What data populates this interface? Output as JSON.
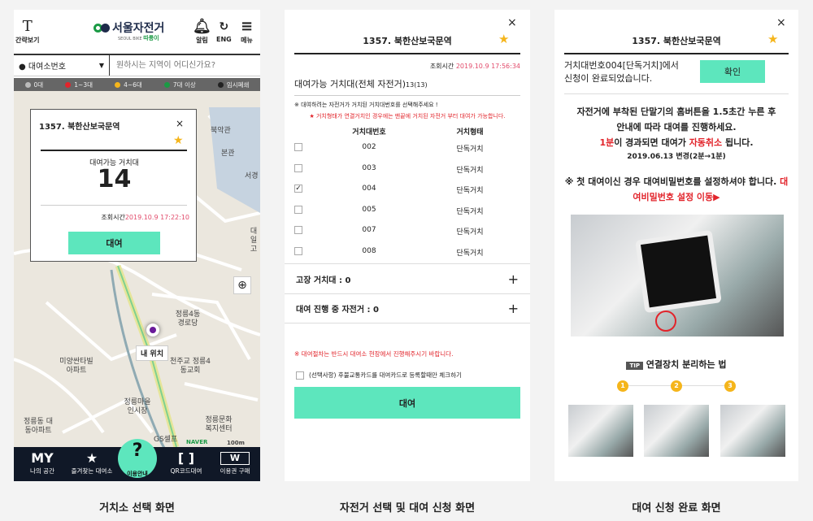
{
  "captions": [
    "거치소 선택 화면",
    "자전거 선택 및 대여 신청 화면",
    "대여 신청 완료 화면"
  ],
  "screen1": {
    "top": {
      "simple": "간략보기",
      "logo": "서울자전거",
      "logo_sub": "SEOUL BIKE",
      "logo_brand": "따릉이",
      "alarm": "알림",
      "eng": "ENG",
      "menu": "메뉴"
    },
    "search": {
      "select": "대여소번호",
      "placeholder": "원하시는 지역이 어디신가요?"
    },
    "legend": [
      {
        "label": "0대",
        "color": "#bbbbbb"
      },
      {
        "label": "1~3대",
        "color": "#e2242b"
      },
      {
        "label": "4~6대",
        "color": "#f5b51b"
      },
      {
        "label": "7대 이상",
        "color": "#1a9a44"
      },
      {
        "label": "임시폐쇄",
        "color": "#222222"
      }
    ],
    "popup": {
      "title": "1357. 북한산보국문역",
      "available_label": "대여가능 거치대",
      "count": "14",
      "time_label": "조회시간",
      "time": "2019.10.9 17:22:10",
      "rent": "대여"
    },
    "map_labels": [
      "북악관",
      "본관",
      "서경",
      "대일 고",
      "정릉4동 경로당",
      "내 위치",
      "천주교 정릉4동교회",
      "미양싼타빌 아파트",
      "정릉마을 인시장",
      "정릉동 대동아파트",
      "GS셀프",
      "정릉문화 복지센터",
      "NAVER",
      "100m"
    ],
    "nav": [
      {
        "icon": "MY",
        "label": "나의 공간"
      },
      {
        "icon": "★",
        "label": "즐겨찾는 대여소"
      },
      {
        "icon": "?",
        "label": "이용안내"
      },
      {
        "icon": "[ ]",
        "label": "QR코드대여"
      },
      {
        "icon": "W",
        "label": "이용권 구매"
      }
    ]
  },
  "screen2": {
    "title": "1357. 북한산보국문역",
    "time_label": "조회시간",
    "time": "2019.10.9 17:56:34",
    "available": "대여가능 거치대(전체 자전거)",
    "available_count": "13(13)",
    "notice1": "※ 대여하려는 자전거가 거치된 거치대번호를 선택해주세요 !",
    "notice2": "★ 거치형태가 연결거치인 경우에는 맨끝에 거치된 자전거 부터 대여가 가능합니다.",
    "columns": [
      "거치대번호",
      "거치형태"
    ],
    "rows": [
      {
        "no": "002",
        "type": "단독거치",
        "checked": false
      },
      {
        "no": "003",
        "type": "단독거치",
        "checked": false
      },
      {
        "no": "004",
        "type": "단독거치",
        "checked": true
      },
      {
        "no": "005",
        "type": "단독거치",
        "checked": false
      },
      {
        "no": "007",
        "type": "단독거치",
        "checked": false
      },
      {
        "no": "008",
        "type": "단독거치",
        "checked": false
      }
    ],
    "broken": "고장 거치대 : 0",
    "in_progress": "대여 진행 중 자전거 : 0",
    "warning": "※ 대여절차는 반드시 대여소 현장에서 진행해주시기 바랍니다.",
    "checkbox": "(선택사항) 후불교통카드를 대여카드로 등록할때만 체크하기",
    "rent": "대여"
  },
  "screen3": {
    "title": "1357. 북한산보국문역",
    "msg1": "거치대번호004[단독거치]에서",
    "msg2": "신청이 완료되었습니다.",
    "confirm": "확인",
    "g1": "자전거에 부착된 단말기의 홈버튼을 1.5초간 누른 후",
    "g2": "안내에 따라 대여를 진행하세요.",
    "g3a": "1분",
    "g3b": "이 경과되면 대여가 ",
    "g3c": "자동취소",
    "g3d": " 됩니다.",
    "g4": "2019.06.13 변경(2분→1분)",
    "p1": "※ 첫 대여이신 경우 대여비밀번호를 설정하셔야 합니다. ",
    "p2": "대여비밀번호 설정 이동▶",
    "tip_badge": "TIP",
    "tip": "연결장치 분리하는 법",
    "steps": [
      "1",
      "2",
      "3"
    ]
  },
  "colors": {
    "accent": "#5de6bd",
    "red": "#e2242b",
    "star": "#f5b51b"
  }
}
